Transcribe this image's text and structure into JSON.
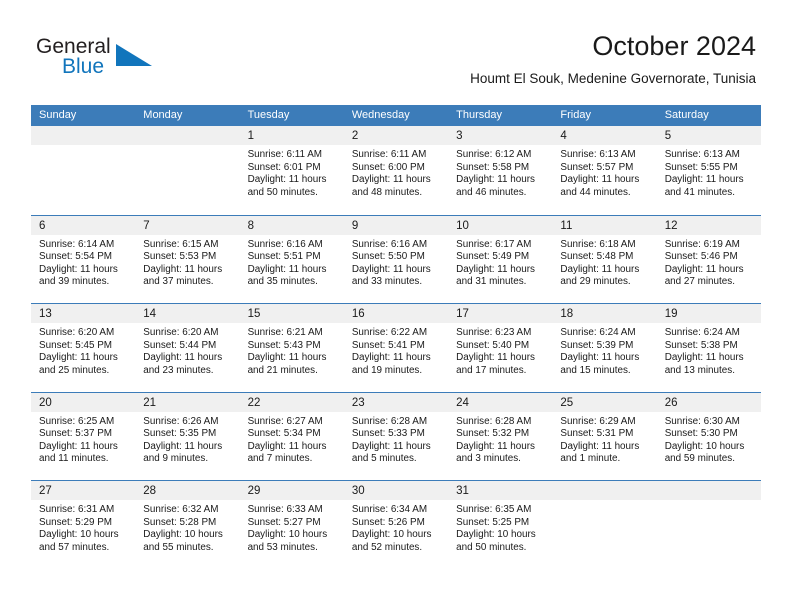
{
  "brand": {
    "name_part1": "General",
    "name_part2": "Blue",
    "logo_icon": "triangle-icon"
  },
  "header": {
    "month_title": "October 2024",
    "location": "Houmt El Souk, Medenine Governorate, Tunisia"
  },
  "colors": {
    "header_blue": "#3c7cb9",
    "brand_blue": "#1175bc",
    "daynum_strip": "#f0f0f0",
    "text": "#1a1a1a"
  },
  "calendar": {
    "weekday_headers": [
      "Sunday",
      "Monday",
      "Tuesday",
      "Wednesday",
      "Thursday",
      "Friday",
      "Saturday"
    ],
    "weeks": [
      [
        {
          "day": "",
          "lines": []
        },
        {
          "day": "",
          "lines": []
        },
        {
          "day": "1",
          "lines": [
            "Sunrise: 6:11 AM",
            "Sunset: 6:01 PM",
            "Daylight: 11 hours",
            "and 50 minutes."
          ]
        },
        {
          "day": "2",
          "lines": [
            "Sunrise: 6:11 AM",
            "Sunset: 6:00 PM",
            "Daylight: 11 hours",
            "and 48 minutes."
          ]
        },
        {
          "day": "3",
          "lines": [
            "Sunrise: 6:12 AM",
            "Sunset: 5:58 PM",
            "Daylight: 11 hours",
            "and 46 minutes."
          ]
        },
        {
          "day": "4",
          "lines": [
            "Sunrise: 6:13 AM",
            "Sunset: 5:57 PM",
            "Daylight: 11 hours",
            "and 44 minutes."
          ]
        },
        {
          "day": "5",
          "lines": [
            "Sunrise: 6:13 AM",
            "Sunset: 5:55 PM",
            "Daylight: 11 hours",
            "and 41 minutes."
          ]
        }
      ],
      [
        {
          "day": "6",
          "lines": [
            "Sunrise: 6:14 AM",
            "Sunset: 5:54 PM",
            "Daylight: 11 hours",
            "and 39 minutes."
          ]
        },
        {
          "day": "7",
          "lines": [
            "Sunrise: 6:15 AM",
            "Sunset: 5:53 PM",
            "Daylight: 11 hours",
            "and 37 minutes."
          ]
        },
        {
          "day": "8",
          "lines": [
            "Sunrise: 6:16 AM",
            "Sunset: 5:51 PM",
            "Daylight: 11 hours",
            "and 35 minutes."
          ]
        },
        {
          "day": "9",
          "lines": [
            "Sunrise: 6:16 AM",
            "Sunset: 5:50 PM",
            "Daylight: 11 hours",
            "and 33 minutes."
          ]
        },
        {
          "day": "10",
          "lines": [
            "Sunrise: 6:17 AM",
            "Sunset: 5:49 PM",
            "Daylight: 11 hours",
            "and 31 minutes."
          ]
        },
        {
          "day": "11",
          "lines": [
            "Sunrise: 6:18 AM",
            "Sunset: 5:48 PM",
            "Daylight: 11 hours",
            "and 29 minutes."
          ]
        },
        {
          "day": "12",
          "lines": [
            "Sunrise: 6:19 AM",
            "Sunset: 5:46 PM",
            "Daylight: 11 hours",
            "and 27 minutes."
          ]
        }
      ],
      [
        {
          "day": "13",
          "lines": [
            "Sunrise: 6:20 AM",
            "Sunset: 5:45 PM",
            "Daylight: 11 hours",
            "and 25 minutes."
          ]
        },
        {
          "day": "14",
          "lines": [
            "Sunrise: 6:20 AM",
            "Sunset: 5:44 PM",
            "Daylight: 11 hours",
            "and 23 minutes."
          ]
        },
        {
          "day": "15",
          "lines": [
            "Sunrise: 6:21 AM",
            "Sunset: 5:43 PM",
            "Daylight: 11 hours",
            "and 21 minutes."
          ]
        },
        {
          "day": "16",
          "lines": [
            "Sunrise: 6:22 AM",
            "Sunset: 5:41 PM",
            "Daylight: 11 hours",
            "and 19 minutes."
          ]
        },
        {
          "day": "17",
          "lines": [
            "Sunrise: 6:23 AM",
            "Sunset: 5:40 PM",
            "Daylight: 11 hours",
            "and 17 minutes."
          ]
        },
        {
          "day": "18",
          "lines": [
            "Sunrise: 6:24 AM",
            "Sunset: 5:39 PM",
            "Daylight: 11 hours",
            "and 15 minutes."
          ]
        },
        {
          "day": "19",
          "lines": [
            "Sunrise: 6:24 AM",
            "Sunset: 5:38 PM",
            "Daylight: 11 hours",
            "and 13 minutes."
          ]
        }
      ],
      [
        {
          "day": "20",
          "lines": [
            "Sunrise: 6:25 AM",
            "Sunset: 5:37 PM",
            "Daylight: 11 hours",
            "and 11 minutes."
          ]
        },
        {
          "day": "21",
          "lines": [
            "Sunrise: 6:26 AM",
            "Sunset: 5:35 PM",
            "Daylight: 11 hours",
            "and 9 minutes."
          ]
        },
        {
          "day": "22",
          "lines": [
            "Sunrise: 6:27 AM",
            "Sunset: 5:34 PM",
            "Daylight: 11 hours",
            "and 7 minutes."
          ]
        },
        {
          "day": "23",
          "lines": [
            "Sunrise: 6:28 AM",
            "Sunset: 5:33 PM",
            "Daylight: 11 hours",
            "and 5 minutes."
          ]
        },
        {
          "day": "24",
          "lines": [
            "Sunrise: 6:28 AM",
            "Sunset: 5:32 PM",
            "Daylight: 11 hours",
            "and 3 minutes."
          ]
        },
        {
          "day": "25",
          "lines": [
            "Sunrise: 6:29 AM",
            "Sunset: 5:31 PM",
            "Daylight: 11 hours",
            "and 1 minute."
          ]
        },
        {
          "day": "26",
          "lines": [
            "Sunrise: 6:30 AM",
            "Sunset: 5:30 PM",
            "Daylight: 10 hours",
            "and 59 minutes."
          ]
        }
      ],
      [
        {
          "day": "27",
          "lines": [
            "Sunrise: 6:31 AM",
            "Sunset: 5:29 PM",
            "Daylight: 10 hours",
            "and 57 minutes."
          ]
        },
        {
          "day": "28",
          "lines": [
            "Sunrise: 6:32 AM",
            "Sunset: 5:28 PM",
            "Daylight: 10 hours",
            "and 55 minutes."
          ]
        },
        {
          "day": "29",
          "lines": [
            "Sunrise: 6:33 AM",
            "Sunset: 5:27 PM",
            "Daylight: 10 hours",
            "and 53 minutes."
          ]
        },
        {
          "day": "30",
          "lines": [
            "Sunrise: 6:34 AM",
            "Sunset: 5:26 PM",
            "Daylight: 10 hours",
            "and 52 minutes."
          ]
        },
        {
          "day": "31",
          "lines": [
            "Sunrise: 6:35 AM",
            "Sunset: 5:25 PM",
            "Daylight: 10 hours",
            "and 50 minutes."
          ]
        },
        {
          "day": "",
          "lines": []
        },
        {
          "day": "",
          "lines": []
        }
      ]
    ]
  }
}
